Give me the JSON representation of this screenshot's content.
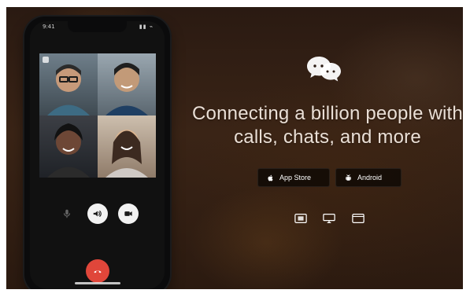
{
  "hero": {
    "headline_line1": "Connecting a billion people with",
    "headline_line2": "calls, chats, and more",
    "brand_icon": "chat-bubbles-icon"
  },
  "stores": {
    "apple_label": "App Store",
    "android_label": "Android"
  },
  "platforms": [
    {
      "name": "windows",
      "icon": "windows-icon"
    },
    {
      "name": "mac",
      "icon": "monitor-icon"
    },
    {
      "name": "web",
      "icon": "browser-icon"
    }
  ],
  "phone": {
    "status_time": "9:41",
    "status_icons": "▮▮ ⌁",
    "controls": {
      "mute_label": "",
      "speaker_label": "",
      "video_label": ""
    }
  },
  "colors": {
    "hero_dark": "#2a1a12",
    "hero_warm": "#3a2416",
    "text": "#eadfd6",
    "hangup": "#e0463a"
  }
}
